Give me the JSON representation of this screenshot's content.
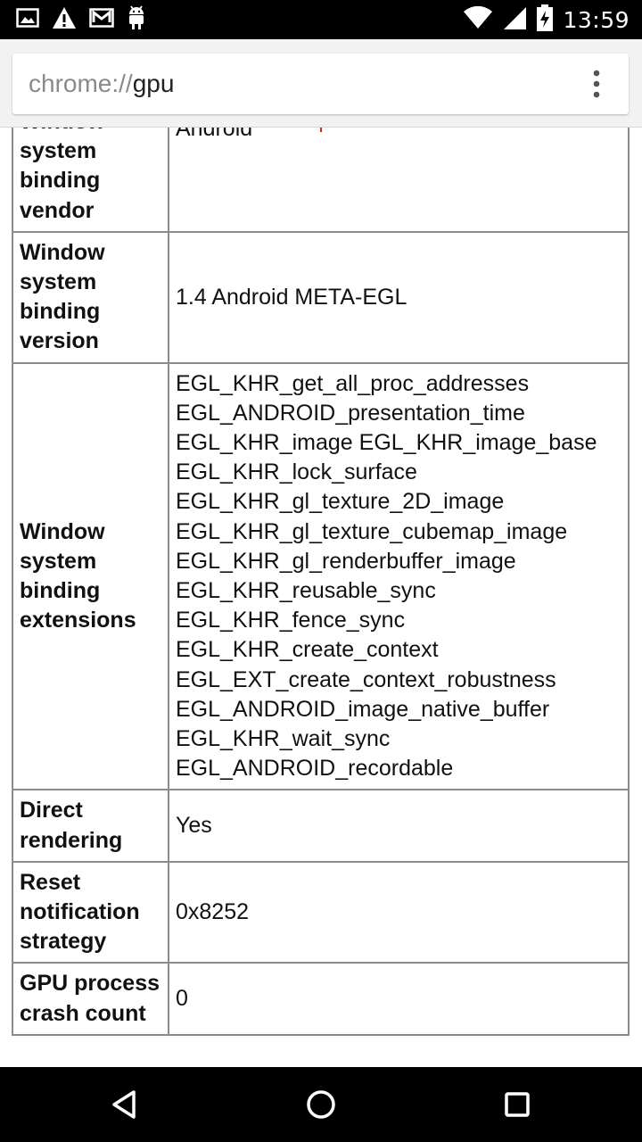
{
  "status_bar": {
    "time": "13:59",
    "left_icons": [
      "image-icon",
      "warning-icon",
      "gmail-icon",
      "android-icon"
    ],
    "right_icons": [
      "wifi-icon",
      "signal-icon",
      "battery-charging-icon"
    ]
  },
  "browser": {
    "url_scheme": "chrome://",
    "url_host": "gpu",
    "menu_icon": "overflow-menu-icon"
  },
  "table": {
    "rows": [
      {
        "label": "Window system binding vendor",
        "value": "Android"
      },
      {
        "label": "Window system binding version",
        "value": "1.4 Android META-EGL"
      },
      {
        "label": "Window system binding extensions",
        "value": "EGL_KHR_get_all_proc_addresses\nEGL_ANDROID_presentation_time\nEGL_KHR_image EGL_KHR_image_base\nEGL_KHR_lock_surface\nEGL_KHR_gl_texture_2D_image\nEGL_KHR_gl_texture_cubemap_image\nEGL_KHR_gl_renderbuffer_image\nEGL_KHR_reusable_sync\nEGL_KHR_fence_sync\nEGL_KHR_create_context\nEGL_EXT_create_context_robustness\nEGL_ANDROID_image_native_buffer\nEGL_KHR_wait_sync\nEGL_ANDROID_recordable"
      },
      {
        "label": "Direct rendering",
        "value": "Yes"
      },
      {
        "label": "Reset notification strategy",
        "value": "0x8252"
      },
      {
        "label": "GPU process crash count",
        "value": "0"
      }
    ]
  },
  "nav_bar": {
    "icons": [
      "back-icon",
      "home-icon",
      "recents-icon"
    ]
  }
}
